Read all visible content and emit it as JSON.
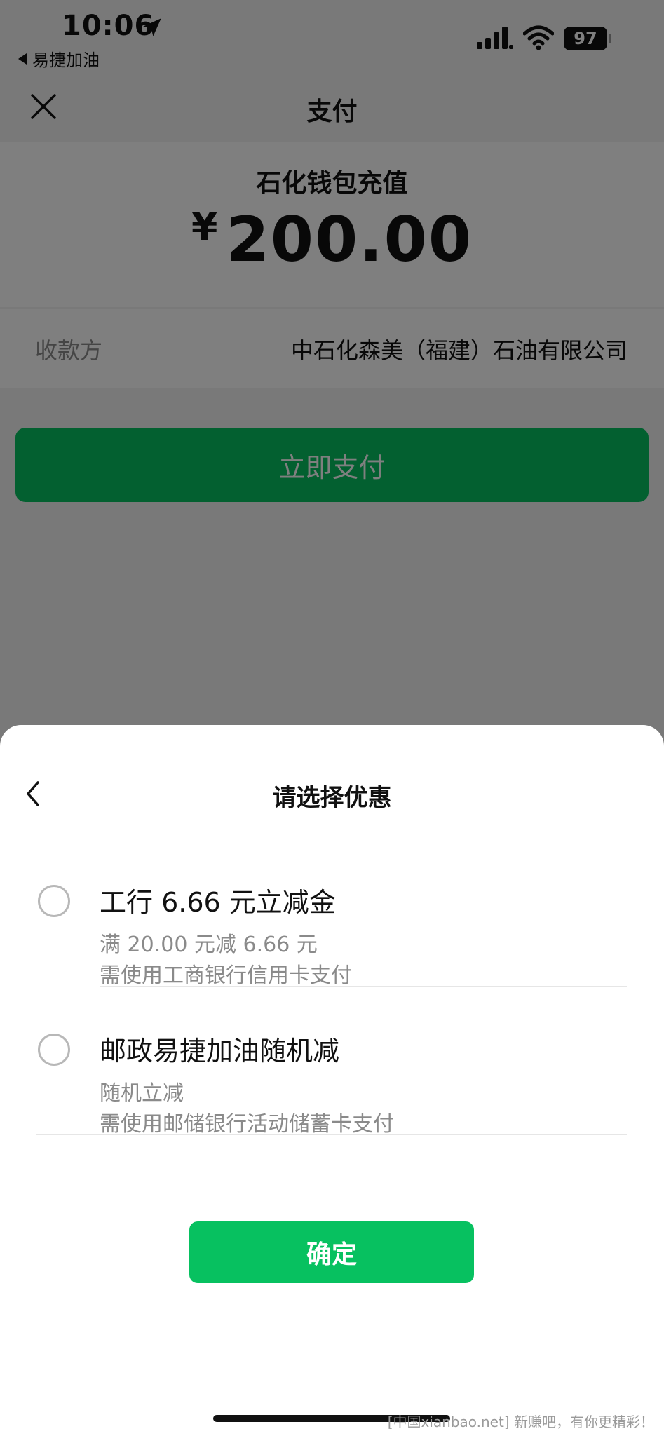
{
  "status_bar": {
    "time": "10:06",
    "back_app": "易捷加油",
    "battery": "97"
  },
  "nav": {
    "title": "支付"
  },
  "order": {
    "name": "石化钱包充值",
    "currency": "¥",
    "amount": "200.00"
  },
  "payee": {
    "label": "收款方",
    "value": "中石化森美（福建）石油有限公司"
  },
  "pay_button": {
    "label": "立即支付"
  },
  "sheet": {
    "title": "请选择优惠",
    "options": [
      {
        "title": "工行 6.66 元立减金",
        "condition": "满 20.00 元减 6.66 元",
        "requirement": "需使用工商银行信用卡支付",
        "selected": false
      },
      {
        "title": "邮政易捷加油随机减",
        "condition": "随机立减",
        "requirement": "需使用邮储银行活动储蓄卡支付",
        "selected": false
      }
    ],
    "confirm_label": "确定"
  },
  "watermark": "[中国xianbao.net] 新赚吧，有你更精彩！",
  "colors": {
    "accent": "#07c160",
    "overlay": "rgba(0,0,0,0.5)"
  }
}
